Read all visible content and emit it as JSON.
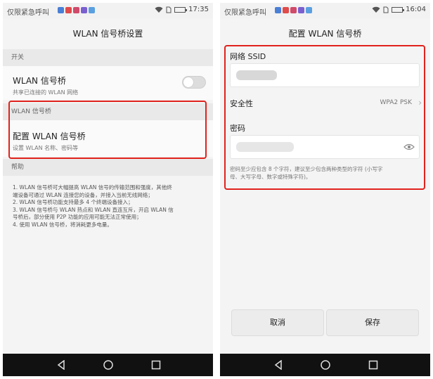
{
  "left": {
    "status": {
      "carrier": "仅限紧急呼叫",
      "time": "17:35"
    },
    "title": "WLAN 信号桥设置",
    "switch_section": "开关",
    "switch_row": {
      "title": "WLAN 信号桥",
      "subtitle": "共享已连接的 WLAN 网络",
      "enabled": false
    },
    "wlan_section": "WLAN 信号桥",
    "config_row": {
      "title": "配置 WLAN 信号桥",
      "subtitle": "设置 WLAN 名称、密码等"
    },
    "help_section": "帮助",
    "help_lines": [
      "1. WLAN 信号桥可大幅提高 WLAN 信号的传输范围和强度，其他终",
      "端设备可通过 WLAN 连接您的设备，并接入当前无线网络；",
      "2. WLAN 信号桥功能支持最多 4 个终端设备接入；",
      "3. WLAN 信号桥与 WLAN 热点和 WLAN 直连互斥，开启 WLAN 信",
      "号桥后，部分使用 P2P 功能的应用可能无法正常使用；",
      "4. 使用 WLAN 信号桥，将消耗更多电量。"
    ]
  },
  "right": {
    "status": {
      "carrier": "仅限紧急呼叫",
      "time": "16:04"
    },
    "title": "配置 WLAN 信号桥",
    "ssid_label": "网络 SSID",
    "security_label": "安全性",
    "security_value": "WPA2 PSK",
    "password_label": "密码",
    "password_hint_line1": "密码至少应包含 8 个字符，建议至少包含两种类型的字符 (小写字",
    "password_hint_line2": "母、大写字母、数字或特殊字符)。",
    "cancel_label": "取消",
    "save_label": "保存"
  },
  "colors": {
    "highlight": "#e0221c",
    "navbar": "#111111"
  },
  "battery_level": 0.8,
  "icons": [
    "wifi-icon",
    "sim-icon",
    "battery-icon",
    "chevron-right-icon",
    "eye-icon",
    "back-icon",
    "home-icon",
    "recent-apps-icon"
  ]
}
